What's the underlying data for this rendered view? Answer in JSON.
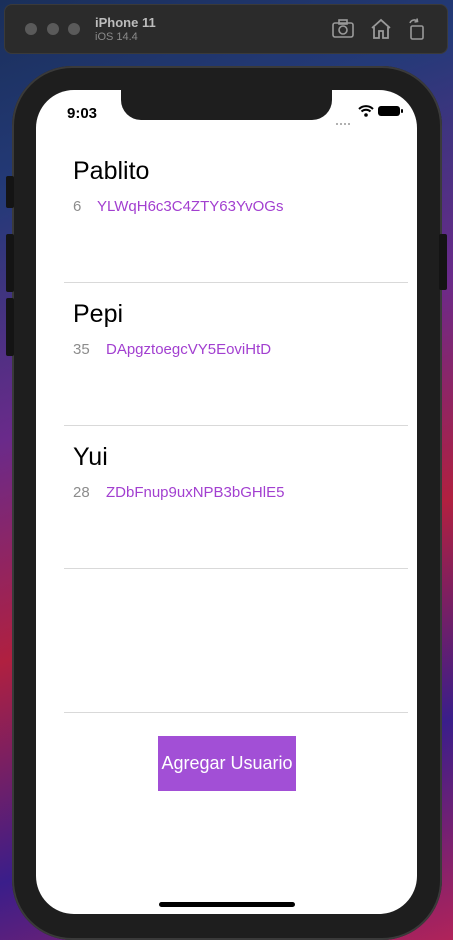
{
  "simulator": {
    "device_name": "iPhone 11",
    "os_version": "iOS 14.4",
    "toolbar_icons": [
      "screenshot-icon",
      "home-icon",
      "rotate-icon"
    ]
  },
  "status_bar": {
    "time": "9:03"
  },
  "users": [
    {
      "name": "Pablito",
      "age": "6",
      "id": "YLWqH6c3C4ZTY63YvOGs"
    },
    {
      "name": "Pepi",
      "age": "35",
      "id": "DApgztoegcVY5EoviHtD"
    },
    {
      "name": "Yui",
      "age": "28",
      "id": "ZDbFnup9uxNPB3bGHlE5"
    }
  ],
  "actions": {
    "add_user_label": "Agregar Usuario"
  },
  "colors": {
    "accent": "#a24fd6",
    "id_text": "#a23fd0",
    "secondary_text": "#8c8c8c"
  }
}
